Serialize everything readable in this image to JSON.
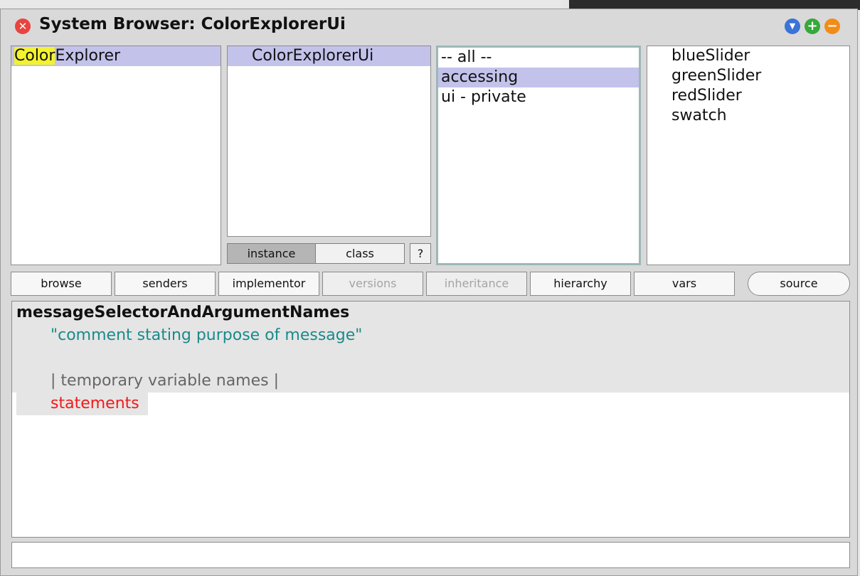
{
  "window": {
    "title": "System Browser: ColorExplorerUi"
  },
  "packages": {
    "items": [
      {
        "highlight": "Color",
        "rest": "Explorer"
      }
    ]
  },
  "classes": {
    "items": [
      "ColorExplorerUi"
    ]
  },
  "class_side_toggle": {
    "instance_label": "instance",
    "class_label": "class",
    "help_label": "?"
  },
  "protocols": {
    "items": [
      "-- all --",
      "accessing",
      "ui - private"
    ]
  },
  "methods": {
    "items": [
      "blueSlider",
      "greenSlider",
      "redSlider",
      "swatch"
    ]
  },
  "toolbar": {
    "browse": "browse",
    "senders": "senders",
    "implementor": "implementor",
    "versions": "versions",
    "inheritance": "inheritance",
    "hierarchy": "hierarchy",
    "vars": "vars",
    "source": "source"
  },
  "editor": {
    "selector_line": "messageSelectorAndArgumentNames",
    "comment_line": "\"comment stating purpose of message\"",
    "temps_line": "| temporary variable names |",
    "statements_line": "statements"
  },
  "colors": {
    "selection": "#c3c2ea",
    "search_highlight": "#f3f22e",
    "comment": "#1a8a8a",
    "statements": "#f21a1a"
  }
}
